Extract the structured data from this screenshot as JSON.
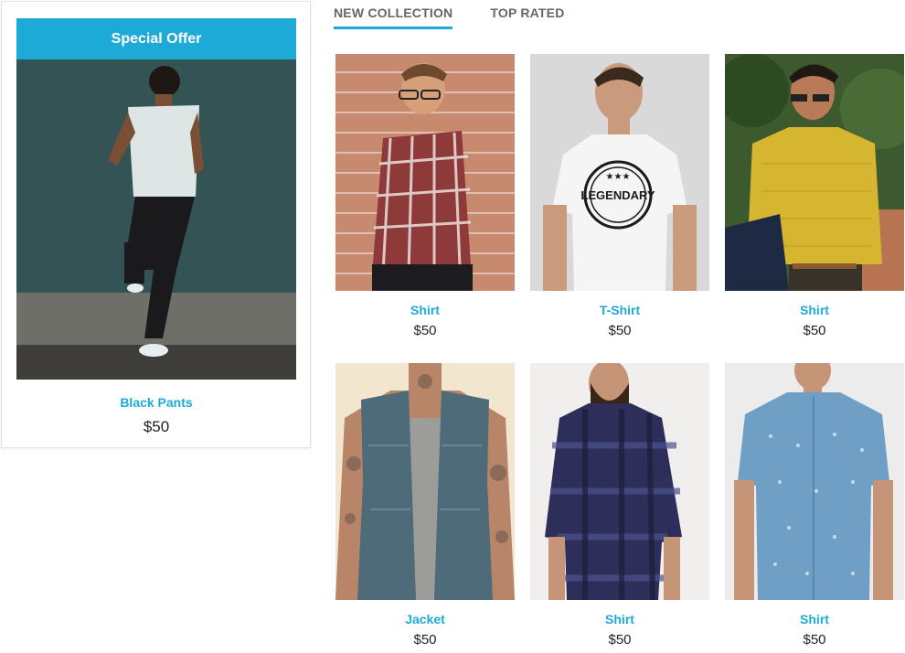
{
  "offer": {
    "header": "Special Offer",
    "product_name": "Black Pants",
    "price": "$50",
    "accent_color": "#1eaad6"
  },
  "tabs": [
    {
      "label": "NEW COLLECTION",
      "active": true
    },
    {
      "label": "TOP RATED",
      "active": false
    }
  ],
  "products": [
    {
      "name": "Shirt",
      "price": "$50"
    },
    {
      "name": "T-Shirt",
      "price": "$50",
      "print": "LEGENDARY"
    },
    {
      "name": "Shirt",
      "price": "$50"
    },
    {
      "name": "Jacket",
      "price": "$50"
    },
    {
      "name": "Shirt",
      "price": "$50"
    },
    {
      "name": "Shirt",
      "price": "$50"
    }
  ]
}
